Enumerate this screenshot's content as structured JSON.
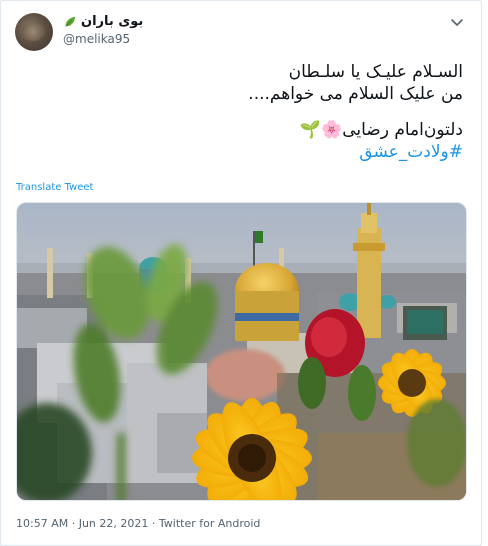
{
  "tweet": {
    "display_name": "بوی باران",
    "handle": "@melika95",
    "lines": [
      "السـلام علیـک یا سلـطان",
      "من علیک السلام می خواهم...."
    ],
    "line3": "دلتون‌امام رضایی",
    "line3_emoji": "🌸🌱",
    "hashtag": "#ولادت_عشق",
    "translate_label": "Translate Tweet",
    "time": "10:57 AM",
    "separator": "·",
    "date": "Jun 22, 2021",
    "source": "Twitter for Android"
  },
  "icons": {
    "leaf": "leaf-icon",
    "more": "more-options-icon",
    "avatar": "avatar-photo"
  },
  "colors": {
    "link": "#1b95e0",
    "muted": "#536471",
    "text": "#0f1419"
  }
}
